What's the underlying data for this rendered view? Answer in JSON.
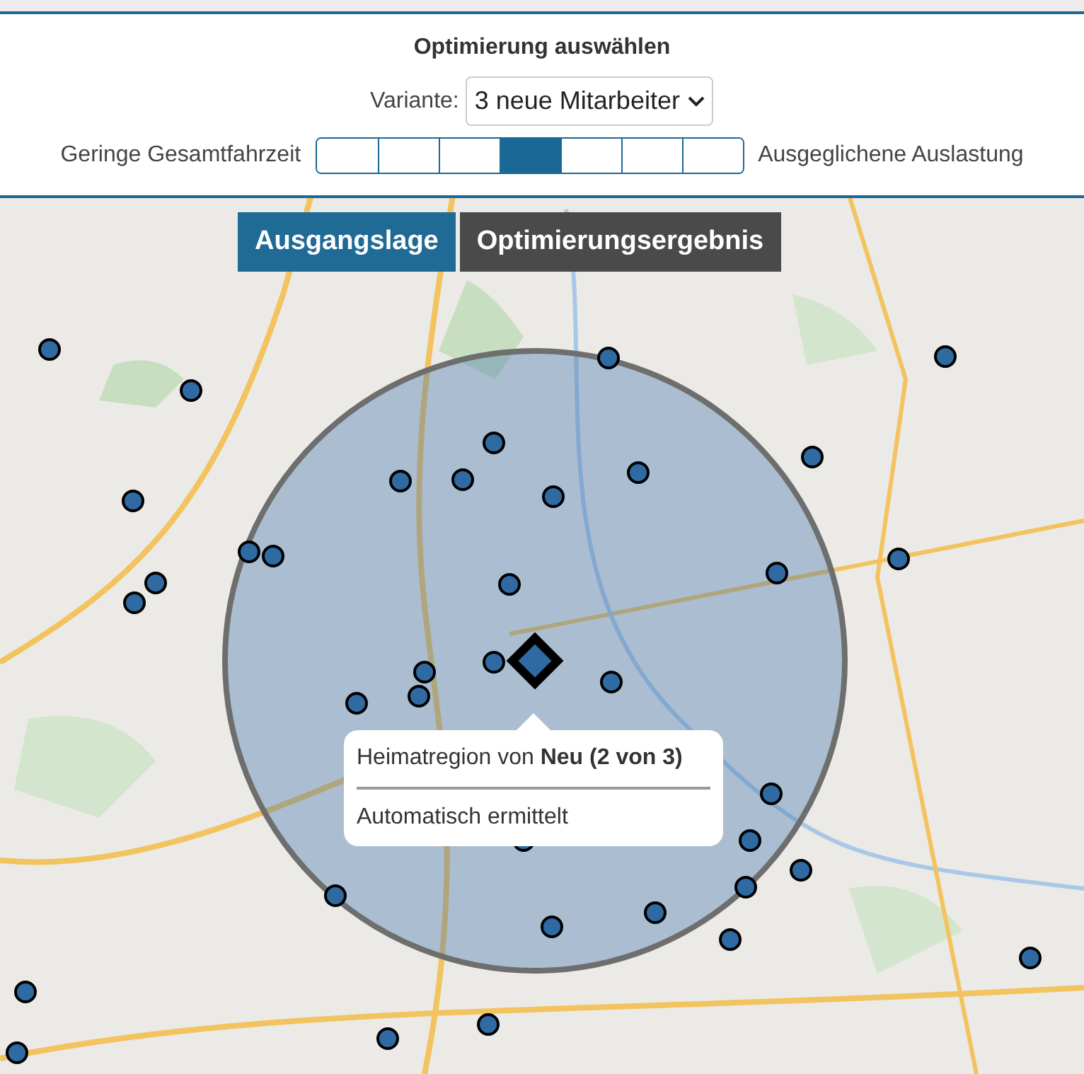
{
  "panel": {
    "title": "Optimierung auswählen",
    "variant_label": "Variante:",
    "variant_value": "3 neue Mitarbeiter",
    "slider": {
      "left_label": "Geringe Gesamtfahrzeit",
      "right_label": "Ausgeglichene Auslastung",
      "segments": [
        {
          "selected": false
        },
        {
          "selected": false
        },
        {
          "selected": false
        },
        {
          "selected": true
        },
        {
          "selected": false
        },
        {
          "selected": false
        },
        {
          "selected": false
        }
      ]
    }
  },
  "tabs": [
    {
      "label": "Ausgangslage",
      "selected": true
    },
    {
      "label": "Optimierungsergebnis",
      "selected": false
    }
  ],
  "popup": {
    "title": "Heimatregion von **Neu (2 von 3)**",
    "note": "Automatisch ermittelt"
  }
}
